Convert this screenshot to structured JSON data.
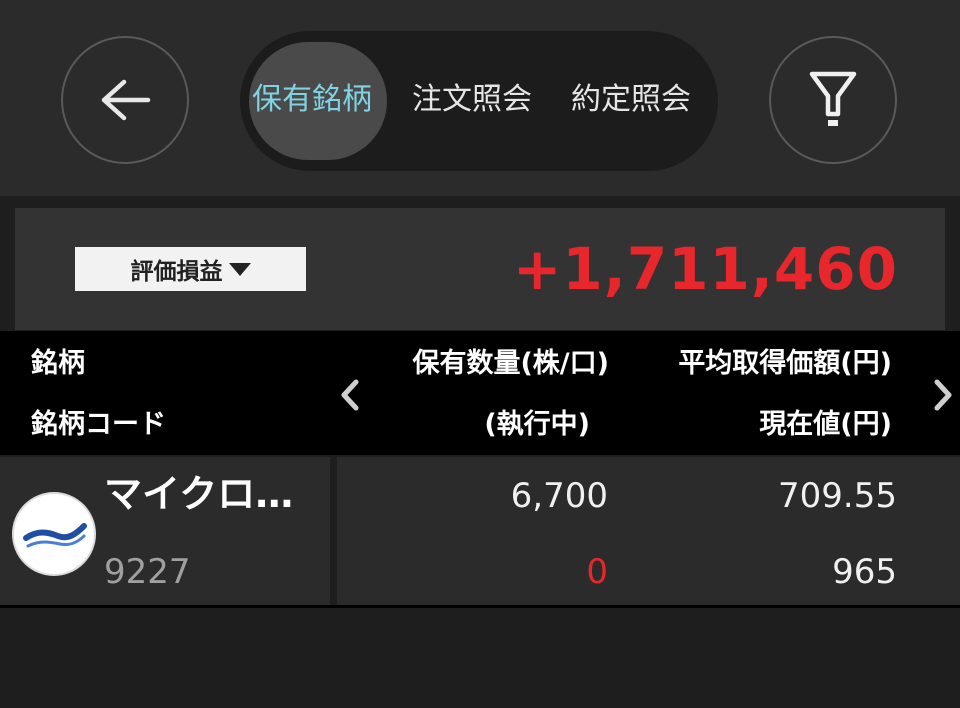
{
  "header": {
    "back_icon": "arrow-left-icon",
    "filter_icon": "filter-icon",
    "tabs": [
      {
        "label": "保有銘柄",
        "active": true
      },
      {
        "label": "注文照会",
        "active": false
      },
      {
        "label": "約定照会",
        "active": false
      }
    ],
    "active_tab_color": "#7fd3e3"
  },
  "summary": {
    "selector_label": "評価損益",
    "selector_icon": "caret-down-icon",
    "value": "+1,711,460",
    "value_color": "#e7272b"
  },
  "columns": {
    "name": "銘柄",
    "code": "銘柄コード",
    "quantity": "保有数量(株/口)",
    "executing": "(執行中)",
    "avg_price": "平均取得価額(円)",
    "current_price": "現在値(円)",
    "prev_icon": "chevron-left-icon",
    "next_icon": "chevron-right-icon"
  },
  "holdings": [
    {
      "name": "マイクロ…",
      "code": "9227",
      "quantity": "6,700",
      "executing": "0",
      "avg_price": "709.55",
      "current_price": "965",
      "logo_icon": "company-logo-icon"
    }
  ]
}
